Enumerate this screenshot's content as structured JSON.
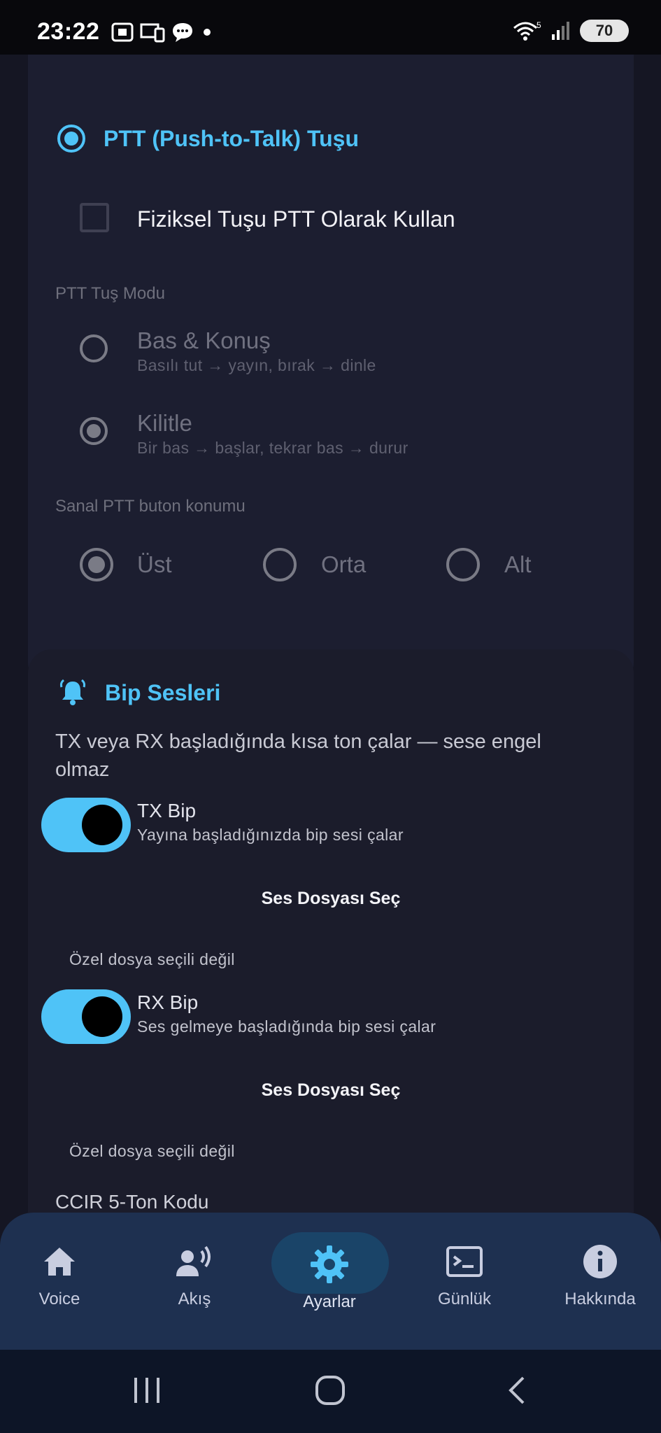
{
  "status_bar": {
    "time": "23:22",
    "battery": "70",
    "signal_label": "5"
  },
  "ptt": {
    "title": "PTT (Push-to-Talk) Tuşu",
    "physical_key_label": "Fiziksel Tuşu PTT Olarak Kullan",
    "mode_label": "PTT Tuş Modu",
    "options": [
      {
        "title": "Bas & Konuş",
        "subtitle": "Basılı tut → yayın, bırak → dinle"
      },
      {
        "title": "Kilitle",
        "subtitle": "Bir bas → başlar, tekrar bas → durur"
      }
    ],
    "position_label": "Sanal PTT buton konumu",
    "positions": [
      "Üst",
      "Orta",
      "Alt"
    ]
  },
  "beep": {
    "title": "Bip Sesleri",
    "description": "TX veya RX başladığında kısa ton çalar — sese engel olmaz",
    "tx": {
      "title": "TX Bip",
      "subtitle": "Yayına başladığınızda bip sesi çalar",
      "button": "Ses Dosyası Seç",
      "file_status": "Özel dosya seçili değil"
    },
    "rx": {
      "title": "RX Bip",
      "subtitle": "Ses gelmeye başladığında bip sesi çalar",
      "button": "Ses Dosyası Seç",
      "file_status": "Özel dosya seçili değil"
    },
    "ccir_label": "CCIR 5-Ton Kodu"
  },
  "nav": {
    "items": [
      {
        "label": "Voice",
        "icon": "home-icon"
      },
      {
        "label": "Akış",
        "icon": "speaker-person-icon"
      },
      {
        "label": "Ayarlar",
        "icon": "gear-icon"
      },
      {
        "label": "Günlük",
        "icon": "terminal-icon"
      },
      {
        "label": "Hakkında",
        "icon": "info-icon"
      }
    ],
    "active": "Ayarlar"
  },
  "colors": {
    "accent": "#4fc3f7",
    "background": "#151623",
    "card": "#1c1e30",
    "nav": "#1e3050"
  }
}
